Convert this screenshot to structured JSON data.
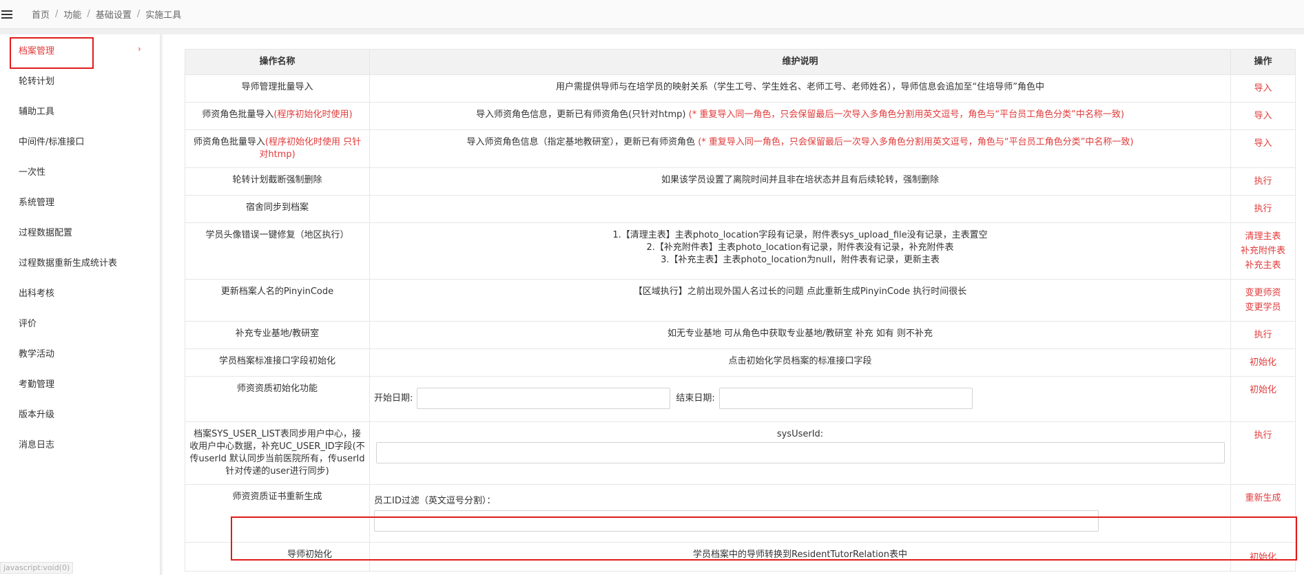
{
  "breadcrumb": [
    "首页",
    "功能",
    "基础设置",
    "实施工具"
  ],
  "sidebar": {
    "items": [
      {
        "label": "档案管理",
        "active": true
      },
      {
        "label": "轮转计划"
      },
      {
        "label": "辅助工具"
      },
      {
        "label": "中间件/标准接口"
      },
      {
        "label": "一次性"
      },
      {
        "label": "系统管理"
      },
      {
        "label": "过程数据配置"
      },
      {
        "label": "过程数据重新生成统计表"
      },
      {
        "label": "出科考核"
      },
      {
        "label": "评价"
      },
      {
        "label": "教学活动"
      },
      {
        "label": "考勤管理"
      },
      {
        "label": "版本升级"
      },
      {
        "label": "消息日志"
      }
    ],
    "chevron": "›"
  },
  "table": {
    "headers": {
      "name": "操作名称",
      "desc": "维护说明",
      "action": "操作"
    },
    "rows": [
      {
        "name": "导师管理批量导入",
        "desc": "用户需提供导师与在培学员的映射关系（学生工号、学生姓名、老师工号、老师姓名），导师信息会追加至“住培导师”角色中",
        "actions": [
          "导入"
        ]
      },
      {
        "name": "师资角色批量导入",
        "name_note": "(程序初始化时使用)",
        "desc": "导入师资角色信息，更新已有师资角色(只针对htmp)",
        "desc_note": "(* 重复导入同一角色，只会保留最后一次导入多角色分割用英文逗号，角色与“平台员工角色分类”中名称一致)",
        "actions": [
          "导入"
        ]
      },
      {
        "name": "师资角色批量导入",
        "name_note": "(程序初始化时使用 只针对htmp)",
        "desc": "导入师资角色信息（指定基地教研室），更新已有师资角色",
        "desc_note": "(* 重复导入同一角色，只会保留最后一次导入多角色分割用英文逗号，角色与“平台员工角色分类”中名称一致)",
        "actions": [
          "导入"
        ]
      },
      {
        "name": "轮转计划截断强制删除",
        "desc": "如果该学员设置了离院时间并且非在培状态并且有后续轮转，强制删除",
        "actions": [
          "执行"
        ]
      },
      {
        "name": "宿舍同步到档案",
        "desc": "",
        "actions": [
          "执行"
        ]
      },
      {
        "name": "学员头像错误一键修复（地区执行）",
        "desc_lines": [
          "1.【清理主表】主表photo_location字段有记录，附件表sys_upload_file没有记录，主表置空",
          "2.【补充附件表】主表photo_location有记录，附件表没有记录，补充附件表",
          "3.【补充主表】主表photo_location为null，附件表有记录，更新主表"
        ],
        "actions": [
          "清理主表",
          "补充附件表",
          "补充主表"
        ]
      },
      {
        "name": "更新档案人名的PinyinCode",
        "desc": "【区域执行】之前出现外国人名过长的问题 点此重新生成PinyinCode 执行时间很长",
        "actions": [
          "变更师资",
          "变更学员"
        ]
      },
      {
        "name": "补充专业基地/教研室",
        "desc": "如无专业基地 可从角色中获取专业基地/教研室 补充 如有 则不补充",
        "actions": [
          "执行"
        ]
      },
      {
        "name": "学员档案标准接口字段初始化",
        "desc": "点击初始化学员档案的标准接口字段",
        "actions": [
          "初始化"
        ]
      },
      {
        "name": "师资资质初始化功能",
        "start_label": "开始日期:",
        "end_label": "结束日期:",
        "actions": [
          "初始化"
        ]
      },
      {
        "name": "档案SYS_USER_LIST表同步用户中心，接收用户中心数据，补充UC_USER_ID字段(不传userId 默认同步当前医院所有，传userId针对传递的user进行同步)",
        "field_label": "sysUserId:",
        "actions": [
          "执行"
        ]
      },
      {
        "name": "师资资质证书重新生成",
        "field_label": "员工ID过滤（英文逗号分割）：",
        "actions": [
          "重新生成"
        ]
      },
      {
        "name": "导师初始化",
        "desc": "学员档案中的导师转换到ResidentTutorRelation表中",
        "actions": [
          "初始化"
        ]
      }
    ]
  },
  "status_bar": "javascript:void(0)"
}
